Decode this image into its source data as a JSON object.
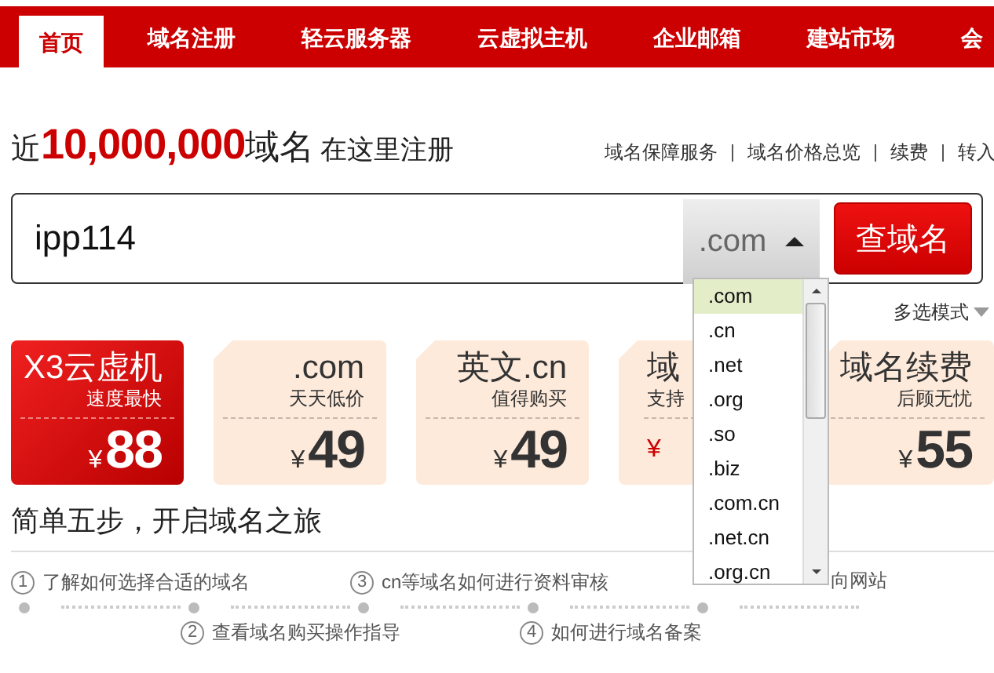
{
  "nav": {
    "tabs": [
      {
        "label": "首页",
        "selected": true
      },
      {
        "label": "域名注册",
        "selected": false
      },
      {
        "label": "轻云服务器",
        "selected": false
      },
      {
        "label": "云虚拟主机",
        "selected": false
      },
      {
        "label": "企业邮箱",
        "selected": false
      },
      {
        "label": "建站市场",
        "selected": false
      },
      {
        "label": "会",
        "selected": false
      }
    ]
  },
  "headline": {
    "prefix": "近",
    "count": "10,000,000",
    "noun": "域名",
    "suffix": "在这里注册"
  },
  "top_links": [
    "域名保障服务",
    "域名价格总览",
    "续费",
    "转入"
  ],
  "search": {
    "value": "ipp114",
    "suffix": ".com",
    "button": "查域名",
    "dropdown_open": true
  },
  "suffix_options": [
    {
      "label": ".com",
      "selected": true
    },
    {
      "label": ".cn",
      "selected": false
    },
    {
      "label": ".net",
      "selected": false
    },
    {
      "label": ".org",
      "selected": false
    },
    {
      "label": ".so",
      "selected": false
    },
    {
      "label": ".biz",
      "selected": false
    },
    {
      "label": ".com.cn",
      "selected": false
    },
    {
      "label": ".net.cn",
      "selected": false
    },
    {
      "label": ".org.cn",
      "selected": false
    }
  ],
  "multi_select": "多选模式",
  "cards": [
    {
      "kind": "promo",
      "title": "X3云虚机",
      "subtitle": "速度最快",
      "currency": "¥",
      "price": "88"
    },
    {
      "kind": "offer",
      "title": ".com",
      "subtitle": "天天低价",
      "currency": "¥",
      "price": "49"
    },
    {
      "kind": "offer",
      "title": "英文.cn",
      "subtitle": "值得购买",
      "currency": "¥",
      "price": "49"
    },
    {
      "kind": "covered",
      "title": "域",
      "subtitle": "支持",
      "currency": "¥"
    },
    {
      "kind": "offer",
      "title": "域名续费",
      "subtitle": "后顾无忧",
      "currency": "¥",
      "price": "55"
    }
  ],
  "steps_title": "简单五步，开启域名之旅",
  "steps": [
    {
      "number": "1",
      "text": "了解如何选择合适的域名",
      "kind": "top"
    },
    {
      "number": "2",
      "text": "查看域名购买操作指导",
      "kind": "bottom"
    },
    {
      "number": "3",
      "text": "cn等域名如何进行资料审核",
      "kind": "top"
    },
    {
      "number": "4",
      "text": "如何进行域名备案",
      "kind": "bottom"
    },
    {
      "text": "向网站",
      "kind": "top"
    }
  ]
}
